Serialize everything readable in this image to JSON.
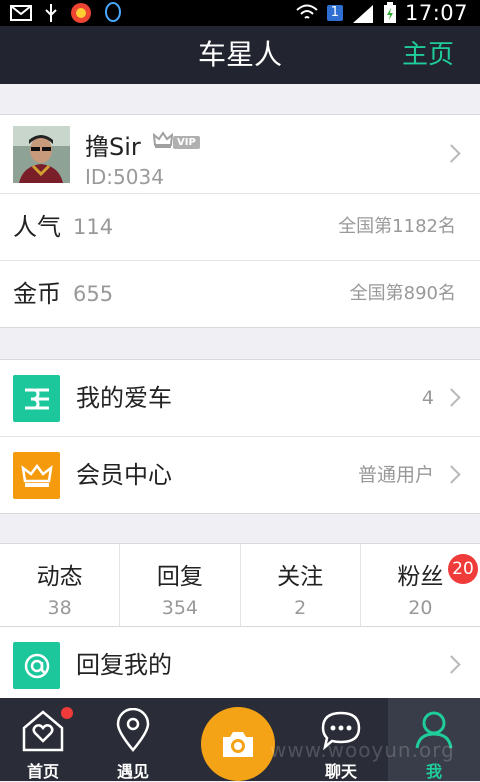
{
  "statusbar": {
    "sim_badge": "1",
    "time": "17:07"
  },
  "header": {
    "title": "车星人",
    "home_link": "主页"
  },
  "profile": {
    "name": "撸Sir",
    "vip_badge": "VIP",
    "user_id": "ID:5034"
  },
  "stats": [
    {
      "label": "人气",
      "value": "114",
      "rank": "全国第1182名"
    },
    {
      "label": "金币",
      "value": "655",
      "rank": "全国第890名"
    }
  ],
  "menu": [
    {
      "label": "我的爱车",
      "value": "4",
      "icon": "car-icon",
      "color": "#1cc79b"
    },
    {
      "label": "会员中心",
      "value": "普通用户",
      "icon": "crown-icon",
      "color": "#f59a0c"
    }
  ],
  "activity": [
    {
      "label": "动态",
      "count": "38"
    },
    {
      "label": "回复",
      "count": "354"
    },
    {
      "label": "关注",
      "count": "2"
    },
    {
      "label": "粉丝",
      "count": "20",
      "badge": "20"
    }
  ],
  "replies": {
    "label": "回复我的",
    "icon": "at-icon",
    "color": "#1cc79b"
  },
  "tabbar": {
    "items": [
      {
        "label": "首页",
        "icon": "home-heart-icon"
      },
      {
        "label": "遇见",
        "icon": "location-pin-icon"
      },
      {
        "label": "",
        "icon": "camera-icon"
      },
      {
        "label": "聊天",
        "icon": "chat-bubble-icon"
      },
      {
        "label": "我",
        "icon": "person-icon",
        "active": true
      }
    ]
  },
  "watermark": "www.wooyun.org",
  "colors": {
    "accent": "#1fcc9a",
    "navbar": "#22252f",
    "tabbar": "#2a2d37",
    "camera": "#f5a316",
    "badge": "#f03b3b"
  }
}
